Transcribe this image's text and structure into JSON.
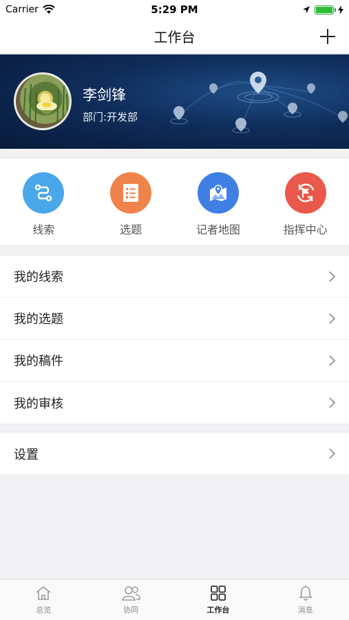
{
  "status_bar": {
    "carrier": "Carrier",
    "time": "5:29 PM"
  },
  "nav": {
    "title": "工作台"
  },
  "profile": {
    "name": "李剑锋",
    "department": "部门:开发部"
  },
  "quick_actions": [
    {
      "label": "线索",
      "icon": "route-icon",
      "color": "#4aa8ea"
    },
    {
      "label": "选题",
      "icon": "list-doc-icon",
      "color": "#f0834a"
    },
    {
      "label": "记者地图",
      "icon": "map-pin-icon",
      "color": "#3f7fe3"
    },
    {
      "label": "指挥中心",
      "icon": "flag-refresh-icon",
      "color": "#e9584a"
    }
  ],
  "menu": {
    "group1": [
      {
        "label": "我的线索"
      },
      {
        "label": "我的选题"
      },
      {
        "label": "我的稿件"
      },
      {
        "label": "我的审核"
      }
    ],
    "group2": [
      {
        "label": "设置"
      }
    ]
  },
  "tabs": [
    {
      "label": "总览",
      "icon": "home-icon",
      "active": false
    },
    {
      "label": "协同",
      "icon": "users-icon",
      "active": false
    },
    {
      "label": "工作台",
      "icon": "grid-icon",
      "active": true
    },
    {
      "label": "消息",
      "icon": "bell-icon",
      "active": false
    }
  ]
}
